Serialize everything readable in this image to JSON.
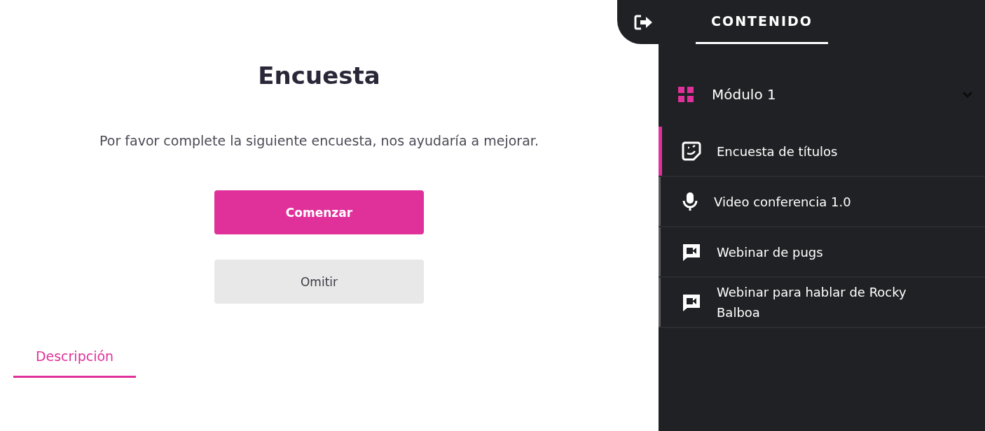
{
  "main": {
    "title": "Encuesta",
    "message": "Por favor complete la siguiente encuesta, nos ayudaría a mejorar.",
    "buttons": [
      {
        "label": "Comenzar",
        "kind": "primary"
      },
      {
        "label": "Omitir",
        "kind": "secondary"
      }
    ],
    "tabs": [
      {
        "label": "Descripción",
        "selected": true
      }
    ]
  },
  "sidebar": {
    "tab": {
      "label": "CONTENIDO",
      "selected": true
    },
    "module": {
      "title": "Módulo 1",
      "expanded": true,
      "items": [
        {
          "label": "Encuesta de títulos",
          "kind": "survey",
          "selected": true
        },
        {
          "label": "Video conferencia 1.0",
          "kind": "audio",
          "selected": false
        },
        {
          "label": "Webinar de pugs",
          "kind": "video",
          "selected": false
        },
        {
          "label": "Webinar para hablar de Rocky Balboa",
          "kind": "video",
          "selected": false
        }
      ]
    }
  }
}
